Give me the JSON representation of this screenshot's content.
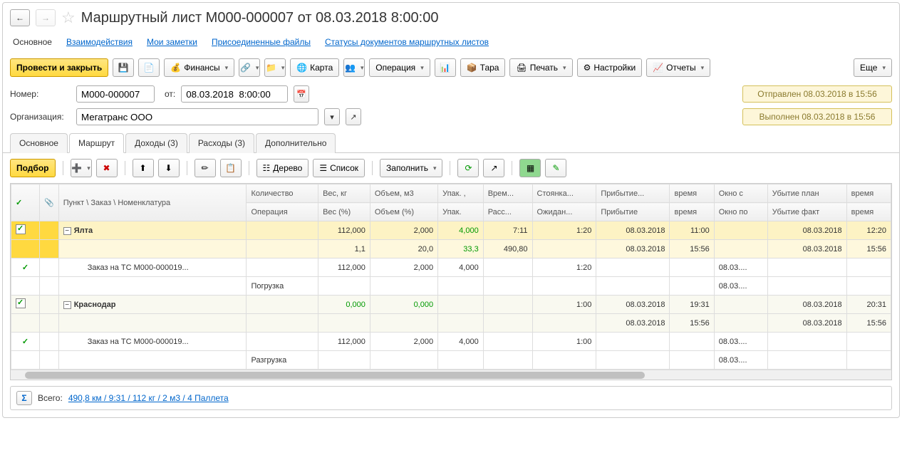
{
  "title": "Маршрутный лист М000-000007 от 08.03.2018 8:00:00",
  "nav": {
    "main": "Основное",
    "inter": "Взаимодействия",
    "notes": "Мои заметки",
    "files": "Присоединенные файлы",
    "statuses": "Статусы документов маршрутных листов"
  },
  "toolbar": {
    "post": "Провести и закрыть",
    "finance": "Финансы",
    "map": "Карта",
    "operation": "Операция",
    "tara": "Тара",
    "print": "Печать",
    "settings": "Настройки",
    "reports": "Отчеты",
    "more": "Еще"
  },
  "fields": {
    "numLabel": "Номер:",
    "numValue": "М000-000007",
    "fromLabel": "от:",
    "fromValue": "08.03.2018  8:00:00",
    "orgLabel": "Организация:",
    "orgValue": "Мегатранс ООО"
  },
  "status": {
    "sent": "Отправлен 08.03.2018 в 15:56",
    "done": "Выполнен 08.03.2018 в 15:56"
  },
  "tabs": {
    "t1": "Основное",
    "t2": "Маршрут",
    "t3": "Доходы (3)",
    "t4": "Расходы (3)",
    "t5": "Дополнительно"
  },
  "sub": {
    "select": "Подбор",
    "tree": "Дерево",
    "list": "Список",
    "fill": "Заполнить"
  },
  "headers": {
    "h1": "Пункт \\ Заказ \\ Номенклатура",
    "h2": "Количество",
    "h3": "Вес, кг",
    "h4": "Объем, м3",
    "h5": "Упак. ,",
    "h6": "Врем...",
    "h7": "Стоянка...",
    "h8": "Прибытие...",
    "h9": "время",
    "h10": "Окно с",
    "h11": "Убытие план",
    "h12": "время",
    "h2b": "Операция",
    "h3b": "Вес (%)",
    "h4b": "Объем (%)",
    "h5b": "Упак.",
    "h6b": "Расс...",
    "h7b": "Ожидан...",
    "h8b": "Прибытие",
    "h9b": "время",
    "h10b": "Окно по",
    "h11b": "Убытие факт",
    "h12b": "время"
  },
  "rows": {
    "r1": {
      "name": "Ялта",
      "wt": "112,000",
      "vol": "2,000",
      "pack": "4,000",
      "time": "7:11",
      "stop": "1:20",
      "arr": "08.03.2018",
      "arrt": "11:00",
      "dep": "08.03.2018",
      "dept": "12:20"
    },
    "r1b": {
      "wtp": "1,1",
      "volp": "20,0",
      "packp": "33,3",
      "dist": "490,80",
      "arr": "08.03.2018",
      "arrt": "15:56",
      "dep": "08.03.2018",
      "dept": "15:56"
    },
    "r2": {
      "name": "Заказ на ТС М000-000019...",
      "op": "Погрузка",
      "wt": "112,000",
      "vol": "2,000",
      "pack": "4,000",
      "stop": "1:20",
      "win": "08.03....",
      "win2": "08.03...."
    },
    "r3": {
      "name": "Краснодар",
      "wt": "0,000",
      "vol": "0,000",
      "stop": "1:00",
      "arr": "08.03.2018",
      "arrt": "19:31",
      "dep": "08.03.2018",
      "dept": "20:31"
    },
    "r3b": {
      "arr": "08.03.2018",
      "arrt": "15:56",
      "dep": "08.03.2018",
      "dept": "15:56"
    },
    "r4": {
      "name": "Заказ на ТС М000-000019...",
      "op": "Разгрузка",
      "wt": "112,000",
      "vol": "2,000",
      "pack": "4,000",
      "stop": "1:00",
      "win": "08.03....",
      "win2": "08.03...."
    }
  },
  "footer": {
    "total": "Всего:",
    "summary": "490,8 км / 9:31 / 112 кг / 2 м3 / 4 Паллета"
  }
}
